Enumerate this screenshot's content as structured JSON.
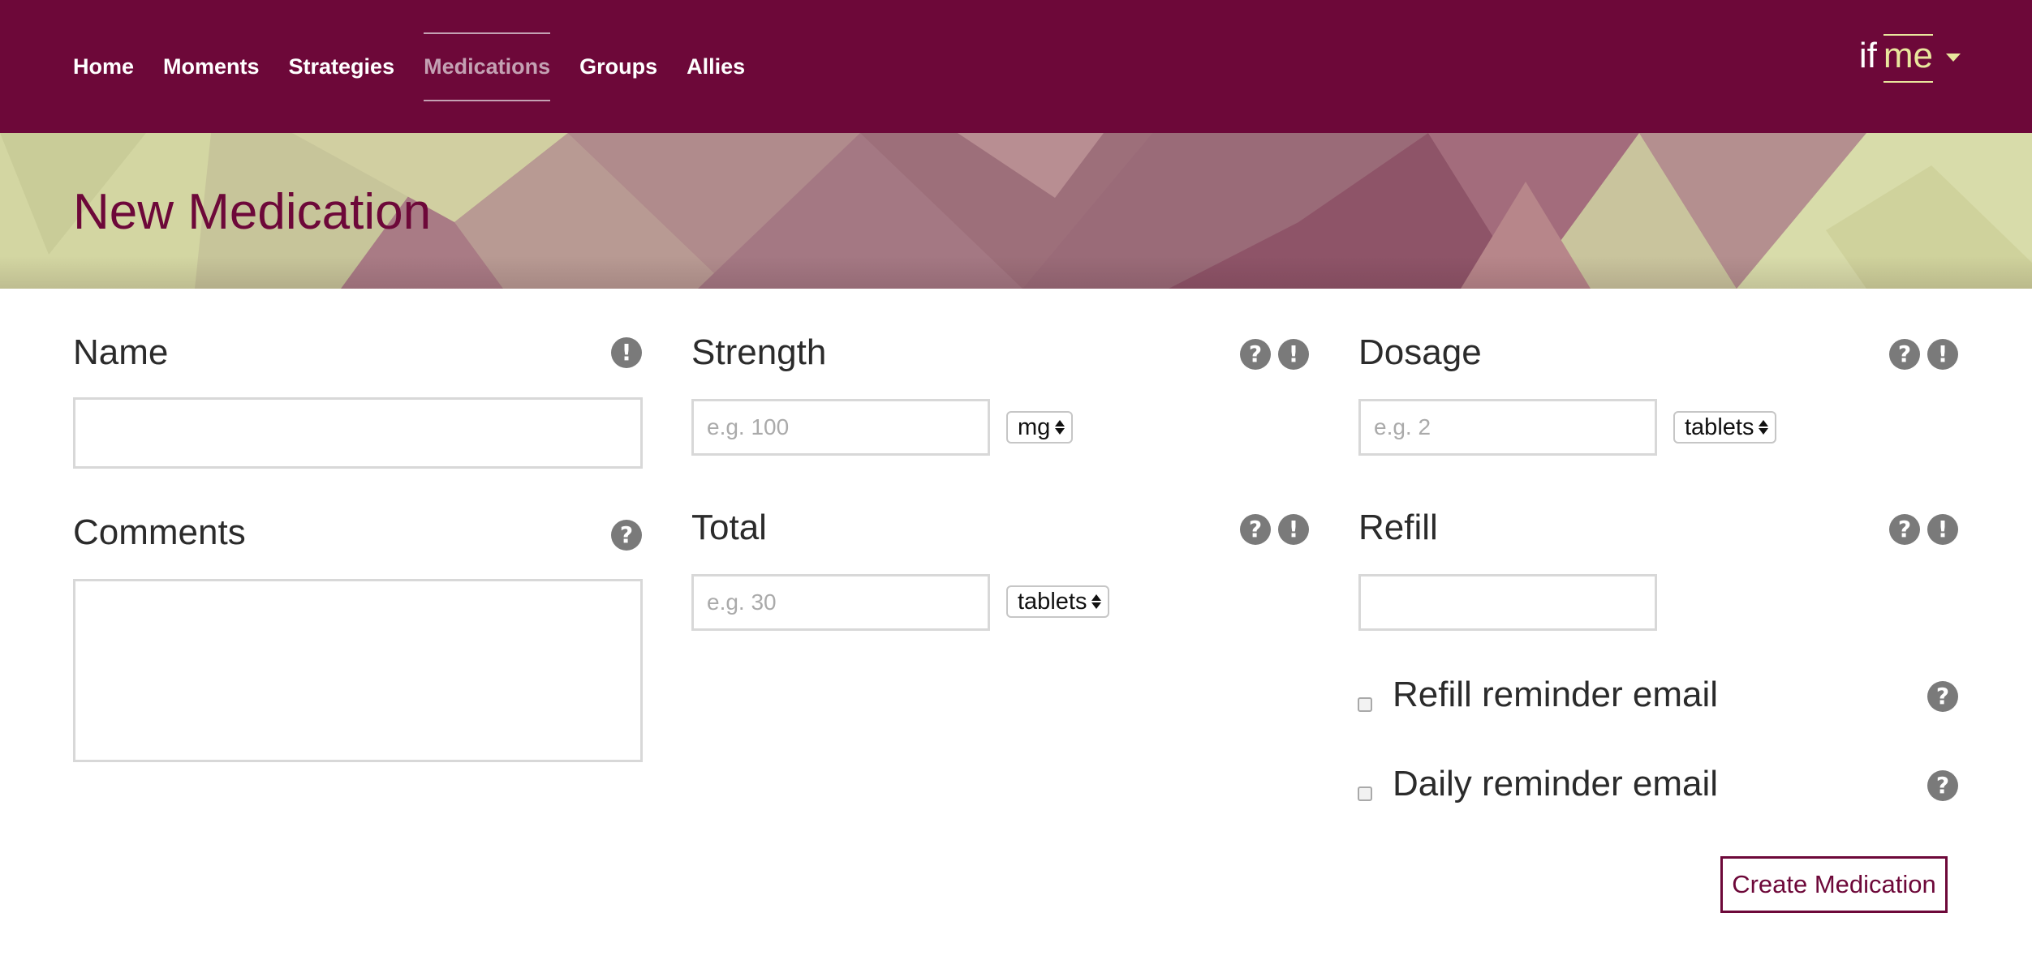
{
  "nav": {
    "links": [
      {
        "label": "Home",
        "active": false
      },
      {
        "label": "Moments",
        "active": false
      },
      {
        "label": "Strategies",
        "active": false
      },
      {
        "label": "Medications",
        "active": true
      },
      {
        "label": "Groups",
        "active": false
      },
      {
        "label": "Allies",
        "active": false
      }
    ],
    "brand_if": "if",
    "brand_me": "me",
    "menu_icon": "caret-down-icon"
  },
  "page": {
    "title": "New Medication"
  },
  "form": {
    "name": {
      "label": "Name",
      "value": "",
      "icons": [
        "exclamation-icon"
      ]
    },
    "comments": {
      "label": "Comments",
      "value": "",
      "icons": [
        "question-icon"
      ]
    },
    "strength": {
      "label": "Strength",
      "placeholder": "e.g. 100",
      "unit": "mg",
      "icons": [
        "question-icon",
        "exclamation-icon"
      ]
    },
    "total": {
      "label": "Total",
      "placeholder": "e.g. 30",
      "unit": "tablets",
      "icons": [
        "question-icon",
        "exclamation-icon"
      ]
    },
    "dosage": {
      "label": "Dosage",
      "placeholder": "e.g. 2",
      "unit": "tablets",
      "icons": [
        "question-icon",
        "exclamation-icon"
      ]
    },
    "refill": {
      "label": "Refill",
      "value": "",
      "icons": [
        "question-icon",
        "exclamation-icon"
      ]
    },
    "refill_reminder": {
      "label": "Refill reminder email",
      "checked": false,
      "icons": [
        "question-icon"
      ]
    },
    "daily_reminder": {
      "label": "Daily reminder email",
      "checked": false,
      "icons": [
        "question-icon"
      ]
    },
    "submit_label": "Create Medication"
  },
  "colors": {
    "primary": "#6d0839",
    "nav_active": "#c4a1b3",
    "brand_accent": "#e9e79d",
    "icon_gray": "#7a7a7a",
    "banner_light": "#d6dca4",
    "banner_dark": "#a8757f"
  }
}
